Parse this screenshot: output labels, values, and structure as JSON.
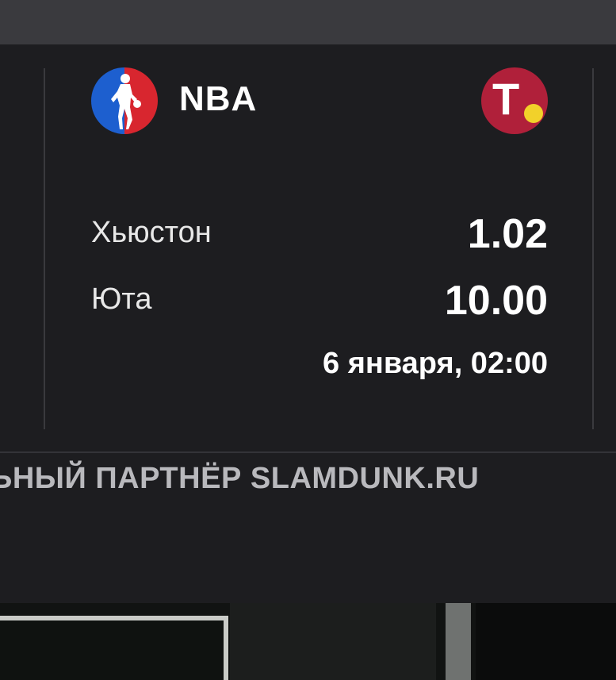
{
  "match": {
    "league": "NBA",
    "league_icon": "nba-logo-icon",
    "bookmaker_icon": "bookmaker-t-logo-icon",
    "bookmaker_letter": "T",
    "home_team": "Хьюстон",
    "away_team": "Юта",
    "home_odds": "1.02",
    "away_odds": "10.00",
    "datetime": "6 января, 02:00"
  },
  "banner": {
    "partner_text": "ЬНЫЙ ПАРТНЁР SLAMDUNK.RU"
  },
  "colors": {
    "background": "#1d1d20",
    "topbar": "#3a3a3e",
    "text": "#ffffff",
    "muted_text": "#b9b9bd",
    "bookmaker_red": "#b0203a",
    "nba_blue": "#1d5fcf",
    "nba_red": "#d8262f"
  }
}
